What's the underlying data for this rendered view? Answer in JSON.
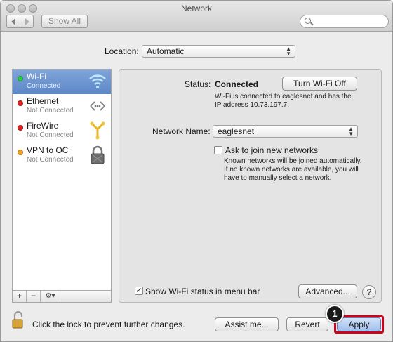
{
  "window": {
    "title": "Network"
  },
  "toolbar": {
    "show_all_label": "Show All",
    "search_placeholder": ""
  },
  "location": {
    "label": "Location:",
    "value": "Automatic"
  },
  "sidebar": {
    "items": [
      {
        "name": "Wi-Fi",
        "status": "Connected",
        "status_color": "#27c93f",
        "icon": "wifi-icon",
        "selected": true
      },
      {
        "name": "Ethernet",
        "status": "Not Connected",
        "status_color": "#e0231f",
        "icon": "ethernet-icon",
        "selected": false
      },
      {
        "name": "FireWire",
        "status": "Not Connected",
        "status_color": "#e0231f",
        "icon": "firewire-icon",
        "selected": false
      },
      {
        "name": "VPN to OC",
        "status": "Not Connected",
        "status_color": "#f0a020",
        "icon": "vpn-lock-icon",
        "selected": false
      }
    ],
    "footer": {
      "add": "+",
      "remove": "−",
      "actions": "⚙▾"
    }
  },
  "detail": {
    "status_label": "Status:",
    "status_value": "Connected",
    "turn_off_button": "Turn Wi-Fi Off",
    "status_desc_line1": "Wi-Fi is connected to eaglesnet and has the",
    "status_desc_line2": "IP address 10.73.197.7.",
    "network_name_label": "Network Name:",
    "network_name_value": "eaglesnet",
    "ask_join_label": "Ask to join new networks",
    "ask_join_checked": false,
    "ask_desc_line1": "Known networks will be joined automatically.",
    "ask_desc_line2": "If no known networks are available, you will",
    "ask_desc_line3": "have to manually select a network.",
    "show_status_label": "Show Wi-Fi status in menu bar",
    "show_status_checked": true,
    "advanced_button": "Advanced...",
    "help_button": "?"
  },
  "footer": {
    "lock_text": "Click the lock to prevent further changes.",
    "assist_button": "Assist me...",
    "revert_button": "Revert",
    "apply_button": "Apply"
  },
  "annotation": {
    "callout_number": "1",
    "highlight_color": "#d0021b"
  }
}
